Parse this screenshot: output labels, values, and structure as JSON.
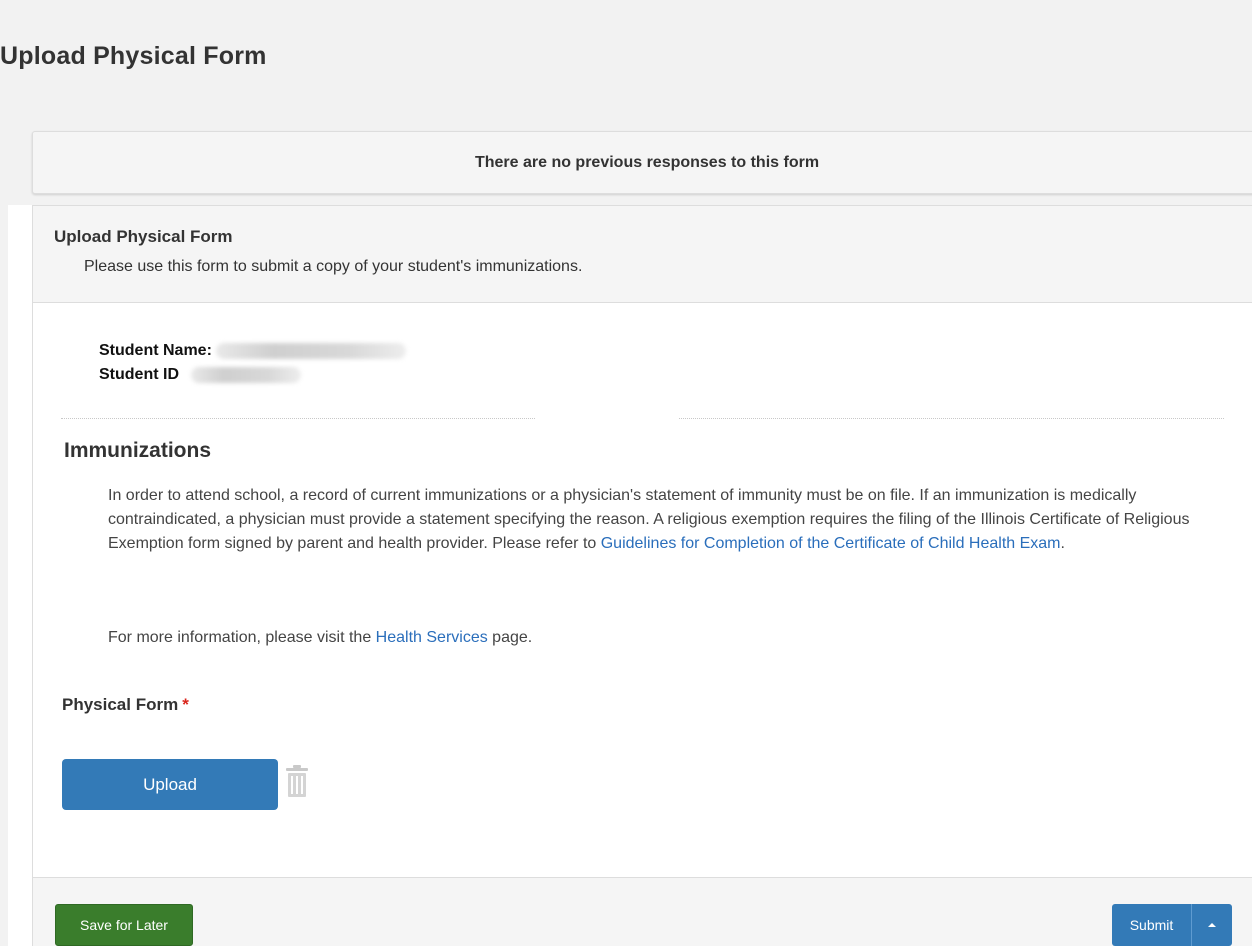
{
  "page": {
    "title": "Upload Physical Form"
  },
  "notice": {
    "text": "There are no previous responses to this form"
  },
  "form": {
    "title": "Upload Physical Form",
    "subtitle": "Please use this form to submit a copy of your student's immunizations.",
    "student_name_label": "Student Name:",
    "student_id_label": "Student ID",
    "section_title": "Immunizations",
    "paragraph_text": "In order to attend school, a record of current immunizations or a physician's statement of immunity must be on file. If an immunization is medically contraindicated, a physician must provide a statement specifying the reason. A religious exemption requires the filing of the Illinois Certificate of Religious Exemption form signed by parent and health provider. Please refer to ",
    "guidelines_link": "Guidelines for Completion of the Certificate of Child Health Exam",
    "paragraph_end": ".",
    "info_prefix": "For more information, please visit the ",
    "health_services_link": "Health Services",
    "info_suffix": " page.",
    "field_label": "Physical Form",
    "required_marker": "*",
    "upload_label": "Upload",
    "trash_icon": "trash-icon"
  },
  "footer": {
    "save_label": "Save for Later",
    "submit_label": "Submit",
    "caret_icon": "caret-up-icon"
  },
  "colors": {
    "primary": "#337ab7",
    "success": "#3a7d2c",
    "link": "#2a6ebb",
    "required": "#d9251c"
  }
}
